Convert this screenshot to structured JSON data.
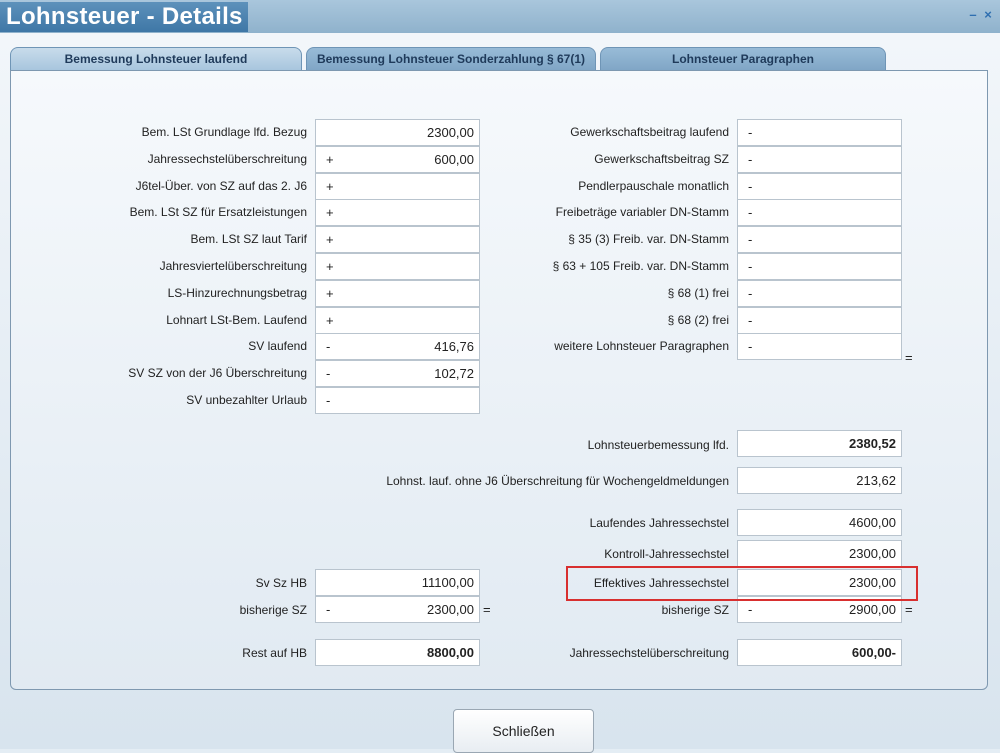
{
  "window": {
    "title": "Lohnsteuer - Details",
    "minimize_label": "–",
    "close_label": "×"
  },
  "tabs": [
    {
      "label": "Bemessung Lohnsteuer laufend"
    },
    {
      "label": "Bemessung Lohnsteuer Sonderzahlung § 67(1)"
    },
    {
      "label": "Lohnsteuer Paragraphen"
    }
  ],
  "left_rows": [
    {
      "label": "Bem. LSt Grundlage lfd. Bezug",
      "sign": "",
      "value": "2300,00"
    },
    {
      "label": "Jahressechstelüberschreitung",
      "sign": "+",
      "value": "600,00"
    },
    {
      "label": "J6tel-Über. von SZ auf das 2. J6",
      "sign": "+",
      "value": ""
    },
    {
      "label": "Bem. LSt SZ  für Ersatzleistungen",
      "sign": "+",
      "value": ""
    },
    {
      "label": "Bem. LSt SZ laut Tarif",
      "sign": "+",
      "value": ""
    },
    {
      "label": "Jahresviertelüberschreitung",
      "sign": "+",
      "value": ""
    },
    {
      "label": "LS-Hinzurechnungsbetrag",
      "sign": "+",
      "value": ""
    },
    {
      "label": "Lohnart LSt-Bem. Laufend",
      "sign": "+",
      "value": ""
    },
    {
      "label": "SV laufend",
      "sign": "-",
      "value": "416,76"
    },
    {
      "label": "SV SZ von der J6 Überschreitung",
      "sign": "-",
      "value": "102,72"
    },
    {
      "label": "SV unbezahlter Urlaub",
      "sign": "-",
      "value": ""
    }
  ],
  "right_rows": [
    {
      "label": "Gewerkschaftsbeitrag laufend",
      "sign": "-",
      "value": ""
    },
    {
      "label": "Gewerkschaftsbeitrag SZ",
      "sign": "-",
      "value": ""
    },
    {
      "label": "Pendlerpauschale monatlich",
      "sign": "-",
      "value": ""
    },
    {
      "label": "Freibeträge variabler DN-Stamm",
      "sign": "-",
      "value": ""
    },
    {
      "label": "§ 35 (3) Freib. var. DN-Stamm",
      "sign": "-",
      "value": ""
    },
    {
      "label": "§ 63 + 105 Freib. var. DN-Stamm",
      "sign": "-",
      "value": ""
    },
    {
      "label": "§ 68 (1) frei",
      "sign": "-",
      "value": ""
    },
    {
      "label": "§ 68 (2) frei",
      "sign": "-",
      "value": ""
    },
    {
      "label": "weitere Lohnsteuer Paragraphen",
      "sign": "-",
      "value": ""
    }
  ],
  "equals": "=",
  "lst_bemessung": {
    "label": "Lohnsteuerbemessung lfd.",
    "value": "2380,52"
  },
  "wochengeld": {
    "label": "Lohnst. lauf. ohne J6 Überschreitung für Wochengeldmeldungen",
    "value": "213,62"
  },
  "sechstel": {
    "laufend": {
      "label": "Laufendes Jahressechstel",
      "value": "4600,00"
    },
    "kontroll": {
      "label": "Kontroll-Jahressechstel",
      "value": "2300,00"
    },
    "effektiv": {
      "label": "Effektives Jahressechstel",
      "value": "2300,00"
    },
    "bisherige": {
      "label": "bisherige SZ",
      "sign": "-",
      "value": "2900,00"
    },
    "ueberschreitung": {
      "label": "Jahressechstelüberschreitung",
      "value": "600,00-"
    }
  },
  "hb": {
    "sv_sz_hb": {
      "label": "Sv Sz HB",
      "value": "11100,00"
    },
    "bisherige": {
      "label": "bisherige SZ",
      "sign": "-",
      "value": "2300,00"
    },
    "rest": {
      "label": "Rest auf HB",
      "value": "8800,00"
    }
  },
  "buttons": {
    "close_label": "Schließen"
  },
  "colors": {
    "highlight": "#d82f2f",
    "title_bg": "#4a83b2"
  }
}
